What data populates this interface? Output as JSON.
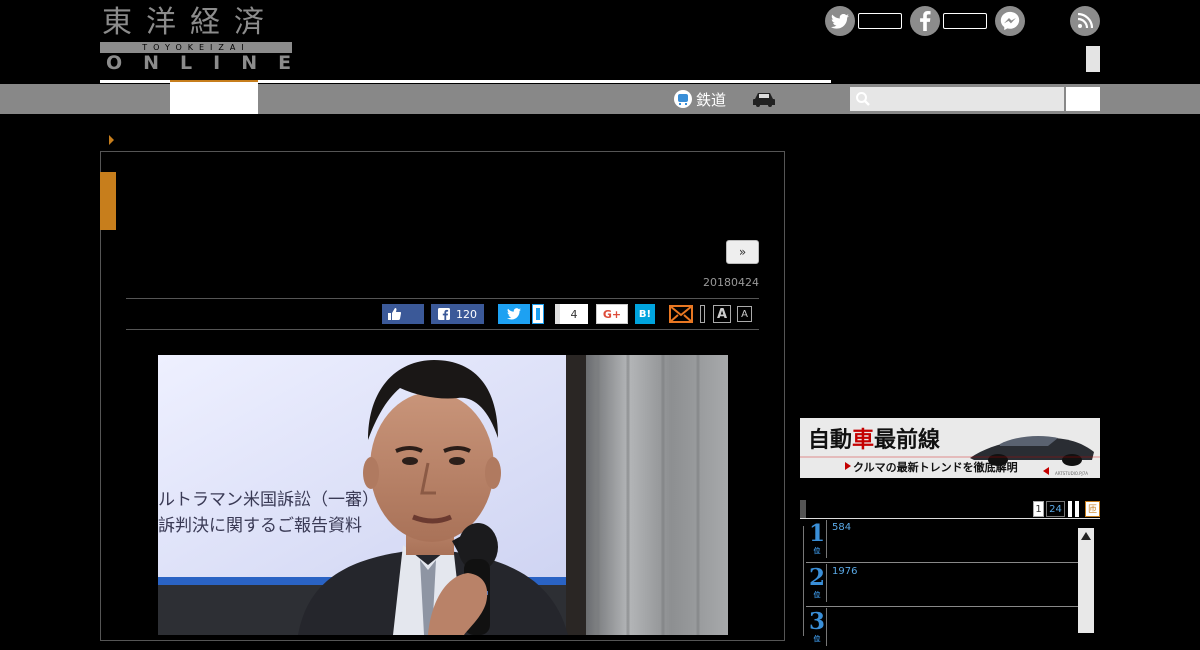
{
  "header": {
    "logo_kanji": "東洋経済",
    "logo_band": "TOYOKEIZAI",
    "logo_online": "ONLINE"
  },
  "nav": {
    "rail_label": "鉄道"
  },
  "article": {
    "next_label": "»",
    "date": "20180424",
    "share": {
      "facebook_count": "120",
      "pocket_count": "4",
      "gplus_label": "G+",
      "hatena_label": "B!",
      "font_large": "A",
      "font_small": "A"
    },
    "photo_slide_lines": [
      "ルトラマン米国訴訟（一審）",
      "訴判決に関するご報告資料"
    ]
  },
  "sidebar": {
    "banner": {
      "title_part1": "自動",
      "title_accent": "車",
      "title_part2": "最前線",
      "subtitle": "クルマの最新トレンドを徹底解明",
      "credit": "ARTSTUDIO.PJ7A"
    },
    "ranking": {
      "tabs": [
        "1",
        "24"
      ],
      "tab_extra": "匝",
      "rank_suffix": "位",
      "items": [
        {
          "rank": "1",
          "value": "584"
        },
        {
          "rank": "2",
          "value": "1976"
        },
        {
          "rank": "3",
          "value": ""
        }
      ]
    }
  },
  "colors": {
    "accent_orange": "#c77e1c",
    "nav_gray": "#888888",
    "rank_blue": "#3a8fd8",
    "twitter": "#1da1f2",
    "facebook": "#3b5998",
    "hatena": "#00a4de"
  }
}
